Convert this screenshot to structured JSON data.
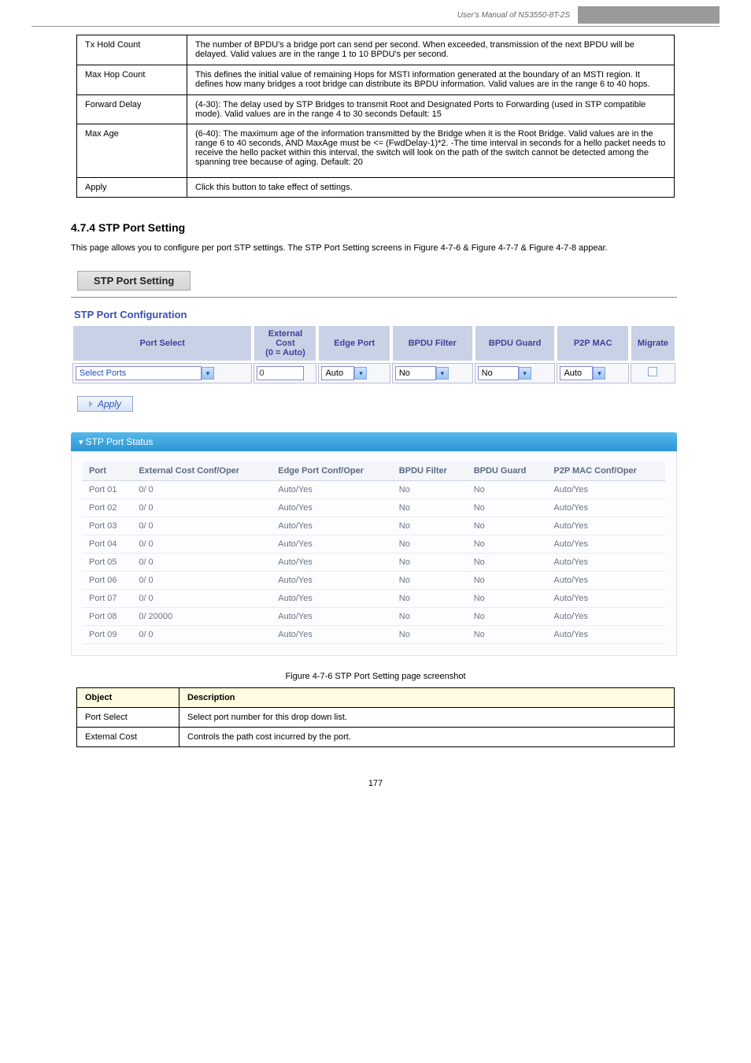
{
  "header": {
    "manual_title": "User's Manual of NS3550-8T-2S"
  },
  "topTable": {
    "rows": [
      {
        "c1": "Tx Hold Count",
        "c2": "The number of BPDU's a bridge port can send per second. When exceeded, transmission of the next BPDU will be delayed. Valid values are in the range 1 to 10 BPDU's per second."
      },
      {
        "c1": "Max Hop Count",
        "c2": "This defines the initial value of remaining Hops for MSTI information generated at the boundary of an MSTI region. It defines how many bridges a root bridge can distribute its BPDU information. Valid values are in the range 6 to 40 hops."
      },
      {
        "c1": "Forward Delay",
        "c2": "(4-30): The delay used by STP Bridges to transmit Root and Designated Ports to Forwarding (used in STP compatible mode). Valid values are in the range 4 to 30 seconds  Default: 15"
      },
      {
        "c1": "Max Age",
        "c2": "(6-40): The maximum age of the information transmitted by the Bridge when it is the Root Bridge. Valid values are in the range 6 to 40 seconds, AND MaxAge must be <= (FwdDelay-1)*2.  -The time interval in seconds for a hello packet needs to receive the hello packet within this interval, the switch will look on the path of the switch cannot be detected among the spanning tree because of aging. Default: 20"
      },
      {
        "c1": "Apply",
        "c2": "Click this button to take effect of settings."
      }
    ]
  },
  "section": {
    "number": "4.7.4 STP Port Setting",
    "desc": "This page allows you to configure per port STP settings. The STP Port Setting screens in Figure 4-7-6 & Figure 4-7-7 & Figure 4-7-8 appear."
  },
  "ui": {
    "titleBar": "STP Port Setting",
    "subtitle": "STP Port Configuration",
    "cfgHeaders": {
      "portSelect": "Port Select",
      "extCost": "External\nCost\n(0 = Auto)",
      "edgePort": "Edge Port",
      "bpduFilter": "BPDU Filter",
      "bpduGuard": "BPDU Guard",
      "p2pMac": "P2P MAC",
      "migrate": "Migrate"
    },
    "cfgInputs": {
      "portSelectValue": "Select Ports",
      "extCostValue": "0",
      "edgePortValue": "Auto",
      "bpduFilterValue": "No",
      "bpduGuardValue": "No",
      "p2pMacValue": "Auto"
    },
    "applyLabel": "Apply",
    "status": {
      "title": "STP Port Status",
      "headers": {
        "port": "Port",
        "extCost": "External Cost Conf/Oper",
        "edge": "Edge Port Conf/Oper",
        "bf": "BPDU Filter",
        "bg": "BPDU Guard",
        "p2p": "P2P MAC Conf/Oper"
      },
      "rows": [
        {
          "port": "Port 01",
          "ext": "0/ 0",
          "edge": "Auto/Yes",
          "bf": "No",
          "bg": "No",
          "p2p": "Auto/Yes"
        },
        {
          "port": "Port 02",
          "ext": "0/ 0",
          "edge": "Auto/Yes",
          "bf": "No",
          "bg": "No",
          "p2p": "Auto/Yes"
        },
        {
          "port": "Port 03",
          "ext": "0/ 0",
          "edge": "Auto/Yes",
          "bf": "No",
          "bg": "No",
          "p2p": "Auto/Yes"
        },
        {
          "port": "Port 04",
          "ext": "0/ 0",
          "edge": "Auto/Yes",
          "bf": "No",
          "bg": "No",
          "p2p": "Auto/Yes"
        },
        {
          "port": "Port 05",
          "ext": "0/ 0",
          "edge": "Auto/Yes",
          "bf": "No",
          "bg": "No",
          "p2p": "Auto/Yes"
        },
        {
          "port": "Port 06",
          "ext": "0/ 0",
          "edge": "Auto/Yes",
          "bf": "No",
          "bg": "No",
          "p2p": "Auto/Yes"
        },
        {
          "port": "Port 07",
          "ext": "0/ 0",
          "edge": "Auto/Yes",
          "bf": "No",
          "bg": "No",
          "p2p": "Auto/Yes"
        },
        {
          "port": "Port 08",
          "ext": "0/ 20000",
          "edge": "Auto/Yes",
          "bf": "No",
          "bg": "No",
          "p2p": "Auto/Yes"
        },
        {
          "port": "Port 09",
          "ext": "0/ 0",
          "edge": "Auto/Yes",
          "bf": "No",
          "bg": "No",
          "p2p": "Auto/Yes"
        }
      ]
    }
  },
  "figCaption": "Figure 4-7-6 STP Port Setting page screenshot",
  "descTable": {
    "headers": {
      "object": "Object",
      "desc": "Description"
    },
    "rows": [
      {
        "object": "Port Select",
        "desc": "Select port number for this drop down list."
      },
      {
        "object": "External Cost",
        "desc": "Controls the path cost incurred by the port."
      }
    ]
  },
  "pageNumber": "177"
}
